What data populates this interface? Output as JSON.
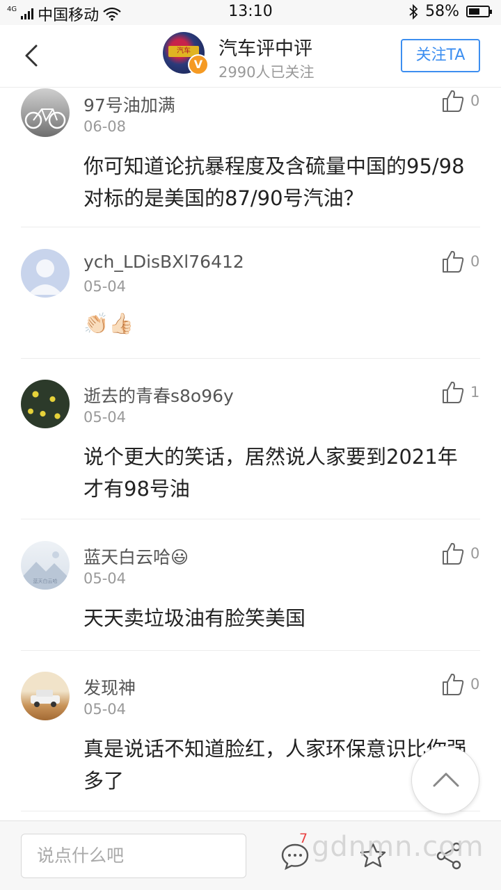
{
  "status_bar": {
    "network": "4G",
    "carrier": "中国移动",
    "time": "13:10",
    "battery": "58%",
    "battery_level": 0.58
  },
  "header": {
    "avatar_text": "汽车",
    "verified_mark": "V",
    "title": "汽车评中评",
    "followers": "2990人已关注",
    "follow_label": "关注TA"
  },
  "comments": [
    {
      "username": "97号油加满",
      "date": "06-08",
      "likes": "0",
      "text": "你可知道论抗暴程度及含硫量中国的95/98对标的是美国的87/90号汽油？"
    },
    {
      "username": "ych_LDisBXl76412",
      "date": "05-04",
      "likes": "0",
      "text": "👏🏻👍🏻"
    },
    {
      "username": "逝去的青春s8o96y",
      "date": "05-04",
      "likes": "1",
      "text": "说个更大的笑话，居然说人家要到2021年才有98号油"
    },
    {
      "username": "蓝天白云哈😃",
      "date": "05-04",
      "likes": "0",
      "text": "天天卖垃圾油有脸笑美国",
      "avatar_caption": "蓝天白云哈"
    },
    {
      "username": "发现神",
      "date": "05-04",
      "likes": "0",
      "text": "真是说话不知道脸红，人家环保意识比你强多了"
    }
  ],
  "bottom_bar": {
    "input_placeholder": "说点什么吧",
    "comment_count": "7",
    "watermark": "gdnmn.com"
  },
  "colors": {
    "accent": "#3c8ef0",
    "badge": "#f59a23",
    "count_red": "#e94141"
  }
}
